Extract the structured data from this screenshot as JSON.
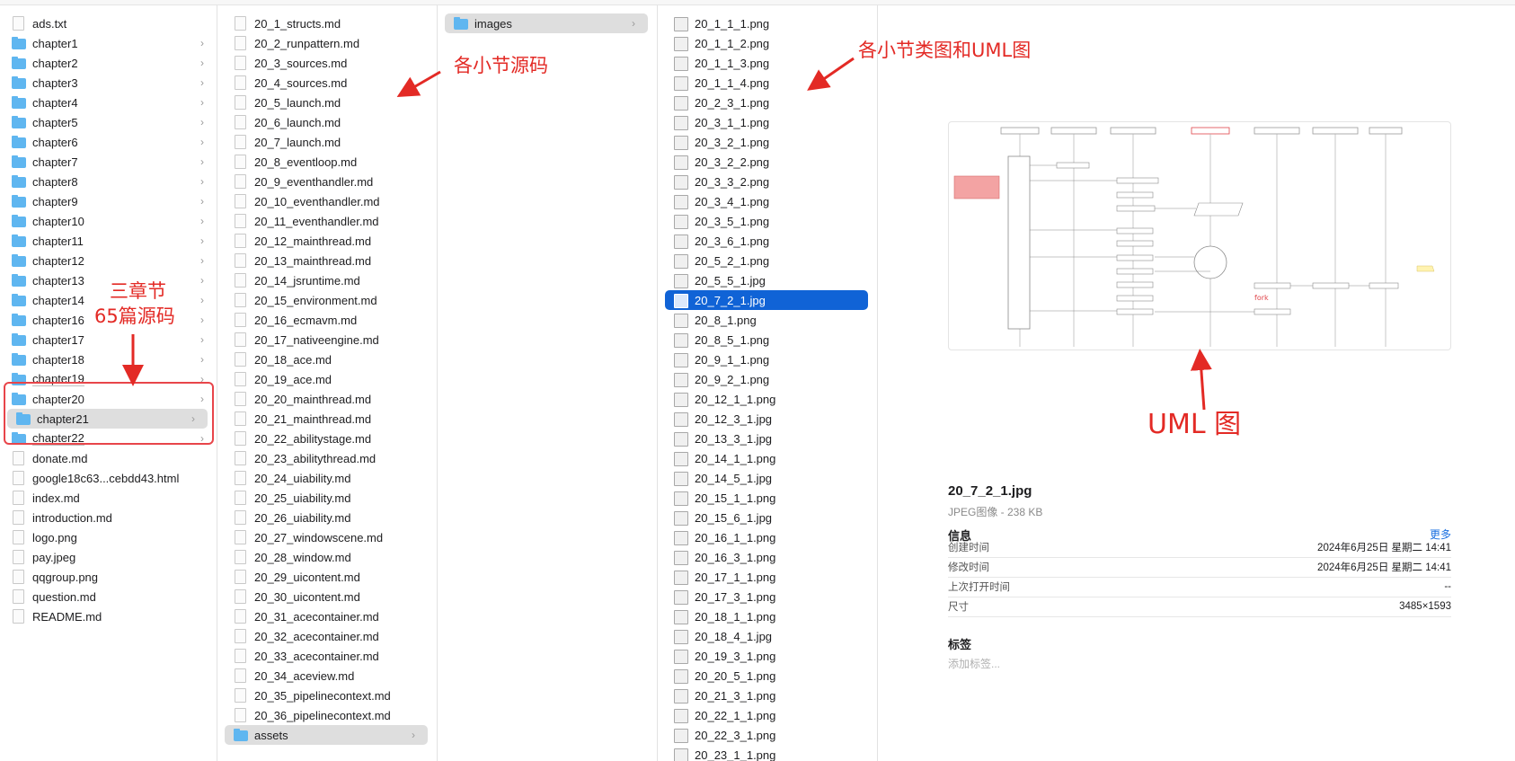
{
  "col1": {
    "items": [
      {
        "label": "ads.txt",
        "kind": "file"
      },
      {
        "label": "chapter1",
        "kind": "folder"
      },
      {
        "label": "chapter2",
        "kind": "folder"
      },
      {
        "label": "chapter3",
        "kind": "folder"
      },
      {
        "label": "chapter4",
        "kind": "folder"
      },
      {
        "label": "chapter5",
        "kind": "folder"
      },
      {
        "label": "chapter6",
        "kind": "folder"
      },
      {
        "label": "chapter7",
        "kind": "folder"
      },
      {
        "label": "chapter8",
        "kind": "folder"
      },
      {
        "label": "chapter9",
        "kind": "folder"
      },
      {
        "label": "chapter10",
        "kind": "folder"
      },
      {
        "label": "chapter11",
        "kind": "folder"
      },
      {
        "label": "chapter12",
        "kind": "folder"
      },
      {
        "label": "chapter13",
        "kind": "folder"
      },
      {
        "label": "chapter14",
        "kind": "folder"
      },
      {
        "label": "chapter16",
        "kind": "folder"
      },
      {
        "label": "chapter17",
        "kind": "folder"
      },
      {
        "label": "chapter18",
        "kind": "folder"
      },
      {
        "label": "chapter19",
        "kind": "folder"
      },
      {
        "label": "chapter20",
        "kind": "folder"
      },
      {
        "label": "chapter21",
        "kind": "folder",
        "state": "open"
      },
      {
        "label": "chapter22",
        "kind": "folder"
      },
      {
        "label": "donate.md",
        "kind": "file"
      },
      {
        "label": "google18c63...cebdd43.html",
        "kind": "file"
      },
      {
        "label": "index.md",
        "kind": "file"
      },
      {
        "label": "introduction.md",
        "kind": "file"
      },
      {
        "label": "logo.png",
        "kind": "file"
      },
      {
        "label": "pay.jpeg",
        "kind": "file"
      },
      {
        "label": "qqgroup.png",
        "kind": "file"
      },
      {
        "label": "question.md",
        "kind": "file"
      },
      {
        "label": "README.md",
        "kind": "file"
      }
    ]
  },
  "col2": {
    "items": [
      {
        "label": "20_1_structs.md",
        "kind": "file"
      },
      {
        "label": "20_2_runpattern.md",
        "kind": "file"
      },
      {
        "label": "20_3_sources.md",
        "kind": "file"
      },
      {
        "label": "20_4_sources.md",
        "kind": "file"
      },
      {
        "label": "20_5_launch.md",
        "kind": "file"
      },
      {
        "label": "20_6_launch.md",
        "kind": "file"
      },
      {
        "label": "20_7_launch.md",
        "kind": "file"
      },
      {
        "label": "20_8_eventloop.md",
        "kind": "file"
      },
      {
        "label": "20_9_eventhandler.md",
        "kind": "file"
      },
      {
        "label": "20_10_eventhandler.md",
        "kind": "file"
      },
      {
        "label": "20_11_eventhandler.md",
        "kind": "file"
      },
      {
        "label": "20_12_mainthread.md",
        "kind": "file"
      },
      {
        "label": "20_13_mainthread.md",
        "kind": "file"
      },
      {
        "label": "20_14_jsruntime.md",
        "kind": "file"
      },
      {
        "label": "20_15_environment.md",
        "kind": "file"
      },
      {
        "label": "20_16_ecmavm.md",
        "kind": "file"
      },
      {
        "label": "20_17_nativeengine.md",
        "kind": "file"
      },
      {
        "label": "20_18_ace.md",
        "kind": "file"
      },
      {
        "label": "20_19_ace.md",
        "kind": "file"
      },
      {
        "label": "20_20_mainthread.md",
        "kind": "file"
      },
      {
        "label": "20_21_mainthread.md",
        "kind": "file"
      },
      {
        "label": "20_22_abilitystage.md",
        "kind": "file"
      },
      {
        "label": "20_23_abilitythread.md",
        "kind": "file"
      },
      {
        "label": "20_24_uiability.md",
        "kind": "file"
      },
      {
        "label": "20_25_uiability.md",
        "kind": "file"
      },
      {
        "label": "20_26_uiability.md",
        "kind": "file"
      },
      {
        "label": "20_27_windowscene.md",
        "kind": "file"
      },
      {
        "label": "20_28_window.md",
        "kind": "file"
      },
      {
        "label": "20_29_uicontent.md",
        "kind": "file"
      },
      {
        "label": "20_30_uicontent.md",
        "kind": "file"
      },
      {
        "label": "20_31_acecontainer.md",
        "kind": "file"
      },
      {
        "label": "20_32_acecontainer.md",
        "kind": "file"
      },
      {
        "label": "20_33_acecontainer.md",
        "kind": "file"
      },
      {
        "label": "20_34_aceview.md",
        "kind": "file"
      },
      {
        "label": "20_35_pipelinecontext.md",
        "kind": "file"
      },
      {
        "label": "20_36_pipelinecontext.md",
        "kind": "file"
      },
      {
        "label": "assets",
        "kind": "folder",
        "state": "open"
      }
    ]
  },
  "col3": {
    "items": [
      {
        "label": "images",
        "kind": "folder",
        "state": "open"
      }
    ]
  },
  "col4": {
    "items": [
      {
        "label": "20_1_1_1.png"
      },
      {
        "label": "20_1_1_2.png"
      },
      {
        "label": "20_1_1_3.png"
      },
      {
        "label": "20_1_1_4.png"
      },
      {
        "label": "20_2_3_1.png"
      },
      {
        "label": "20_3_1_1.png"
      },
      {
        "label": "20_3_2_1.png"
      },
      {
        "label": "20_3_2_2.png"
      },
      {
        "label": "20_3_3_2.png"
      },
      {
        "label": "20_3_4_1.png"
      },
      {
        "label": "20_3_5_1.png"
      },
      {
        "label": "20_3_6_1.png"
      },
      {
        "label": "20_5_2_1.png"
      },
      {
        "label": "20_5_5_1.jpg"
      },
      {
        "label": "20_7_2_1.jpg",
        "state": "selected"
      },
      {
        "label": "20_8_1.png"
      },
      {
        "label": "20_8_5_1.png"
      },
      {
        "label": "20_9_1_1.png"
      },
      {
        "label": "20_9_2_1.png"
      },
      {
        "label": "20_12_1_1.png"
      },
      {
        "label": "20_12_3_1.jpg"
      },
      {
        "label": "20_13_3_1.jpg"
      },
      {
        "label": "20_14_1_1.png"
      },
      {
        "label": "20_14_5_1.jpg"
      },
      {
        "label": "20_15_1_1.png"
      },
      {
        "label": "20_15_6_1.jpg"
      },
      {
        "label": "20_16_1_1.png"
      },
      {
        "label": "20_16_3_1.png"
      },
      {
        "label": "20_17_1_1.png"
      },
      {
        "label": "20_17_3_1.png"
      },
      {
        "label": "20_18_1_1.png"
      },
      {
        "label": "20_18_4_1.jpg"
      },
      {
        "label": "20_19_3_1.png"
      },
      {
        "label": "20_20_5_1.png"
      },
      {
        "label": "20_21_3_1.png"
      },
      {
        "label": "20_22_1_1.png"
      },
      {
        "label": "20_22_3_1.png"
      },
      {
        "label": "20_23_1_1.png"
      }
    ]
  },
  "preview": {
    "file_name": "20_7_2_1.jpg",
    "file_type": "JPEG图像 - 238 KB",
    "info_header": "信息",
    "more_label": "更多",
    "info_rows": [
      {
        "key": "创建时间",
        "value": "2024年6月25日 星期二 14:41"
      },
      {
        "key": "修改时间",
        "value": "2024年6月25日 星期二 14:41"
      },
      {
        "key": "上次打开时间",
        "value": "--"
      },
      {
        "key": "尺寸",
        "value": "3485×1593"
      }
    ],
    "tags_header": "标签",
    "tags_placeholder": "添加标签...",
    "thumbnail_text": "fork"
  },
  "annotations": {
    "source_note": "各小节源码",
    "images_note": "各小节类图和UML图",
    "chapters_note_line1": "三章节",
    "chapters_note_line2": "65篇源码",
    "uml_note": "UML 图"
  },
  "colors": {
    "selection_blue": "#1063d6",
    "annotation_red": "#e32a25",
    "folder_blue": "#5fb6f0",
    "link_blue": "#1a6fe0"
  }
}
